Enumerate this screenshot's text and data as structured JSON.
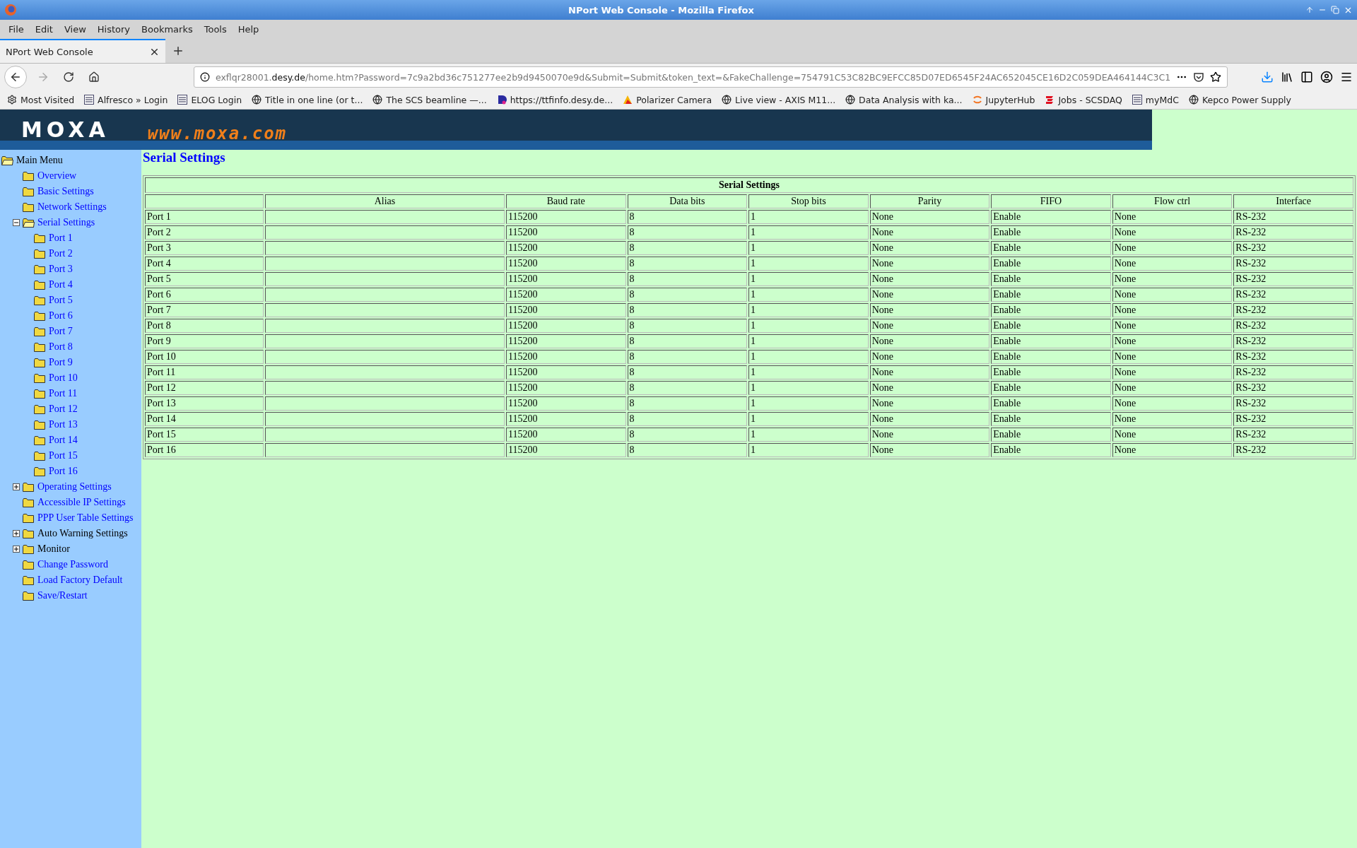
{
  "window": {
    "title": "NPort Web Console - Mozilla Firefox"
  },
  "menu_bar": [
    "File",
    "Edit",
    "View",
    "History",
    "Bookmarks",
    "Tools",
    "Help"
  ],
  "tabs": [
    {
      "label": "NPort Web Console",
      "selected": true
    }
  ],
  "url": {
    "subdomain": "exflqr28001.",
    "domain": "desy.de",
    "path": "/home.htm?Password=7c9a2bd36c751277ee2b9d9450070e9d&Submit=Submit&token_text=&FakeChallenge=754791C53C82BC9EFCC85D07ED6545F24AC652045CE16D2C059DEA464144C3C1"
  },
  "bookmarks": [
    "Most Visited",
    "Alfresco » Login",
    "ELOG Login",
    "Title in one line (or t...",
    "The SCS beamline —...",
    "https://ttfinfo.desy.de...",
    "Polarizer Camera",
    "Live view - AXIS M11...",
    "Data Analysis with ka...",
    "JupyterHub",
    "Jobs - SCSDAQ",
    "myMdC",
    "Kepco Power Supply"
  ],
  "banner": {
    "logo": "MOXA",
    "site": "www.moxa.com"
  },
  "sidebar": {
    "items": [
      {
        "label": "Main Menu",
        "link": false,
        "expanded": true,
        "children": [
          {
            "label": "Overview",
            "link": true
          },
          {
            "label": "Basic Settings",
            "link": true
          },
          {
            "label": "Network Settings",
            "link": true
          },
          {
            "label": "Serial Settings",
            "link": true,
            "expanded": true,
            "children": [
              {
                "label": "Port 1",
                "link": true
              },
              {
                "label": "Port 2",
                "link": true
              },
              {
                "label": "Port 3",
                "link": true
              },
              {
                "label": "Port 4",
                "link": true
              },
              {
                "label": "Port 5",
                "link": true
              },
              {
                "label": "Port 6",
                "link": true
              },
              {
                "label": "Port 7",
                "link": true
              },
              {
                "label": "Port 8",
                "link": true
              },
              {
                "label": "Port 9",
                "link": true
              },
              {
                "label": "Port 10",
                "link": true
              },
              {
                "label": "Port 11",
                "link": true
              },
              {
                "label": "Port 12",
                "link": true
              },
              {
                "label": "Port 13",
                "link": true
              },
              {
                "label": "Port 14",
                "link": true
              },
              {
                "label": "Port 15",
                "link": true
              },
              {
                "label": "Port 16",
                "link": true
              }
            ]
          },
          {
            "label": "Operating Settings",
            "link": true,
            "expanded": false
          },
          {
            "label": "Accessible IP Settings",
            "link": true
          },
          {
            "label": "PPP User Table Settings",
            "link": true
          },
          {
            "label": "Auto Warning Settings",
            "link": false,
            "expanded": false
          },
          {
            "label": "Monitor",
            "link": false,
            "expanded": false
          },
          {
            "label": "Change Password",
            "link": true
          },
          {
            "label": "Load Factory Default",
            "link": true
          },
          {
            "label": "Save/Restart",
            "link": true
          }
        ]
      }
    ]
  },
  "page_title": "Serial Settings",
  "table": {
    "caption": "Serial Settings",
    "columns": [
      "Alias",
      "Baud rate",
      "Data bits",
      "Stop bits",
      "Parity",
      "FIFO",
      "Flow ctrl",
      "Interface"
    ],
    "rows": [
      {
        "port": "Port 1",
        "baud_rate": "115200",
        "data_bits": "8",
        "stop_bits": "1",
        "parity": "None",
        "fifo": "Enable",
        "flow_ctrl": "None",
        "interface": "RS-232"
      },
      {
        "port": "Port 2",
        "baud_rate": "115200",
        "data_bits": "8",
        "stop_bits": "1",
        "parity": "None",
        "fifo": "Enable",
        "flow_ctrl": "None",
        "interface": "RS-232"
      },
      {
        "port": "Port 3",
        "baud_rate": "115200",
        "data_bits": "8",
        "stop_bits": "1",
        "parity": "None",
        "fifo": "Enable",
        "flow_ctrl": "None",
        "interface": "RS-232"
      },
      {
        "port": "Port 4",
        "baud_rate": "115200",
        "data_bits": "8",
        "stop_bits": "1",
        "parity": "None",
        "fifo": "Enable",
        "flow_ctrl": "None",
        "interface": "RS-232"
      },
      {
        "port": "Port 5",
        "baud_rate": "115200",
        "data_bits": "8",
        "stop_bits": "1",
        "parity": "None",
        "fifo": "Enable",
        "flow_ctrl": "None",
        "interface": "RS-232"
      },
      {
        "port": "Port 6",
        "baud_rate": "115200",
        "data_bits": "8",
        "stop_bits": "1",
        "parity": "None",
        "fifo": "Enable",
        "flow_ctrl": "None",
        "interface": "RS-232"
      },
      {
        "port": "Port 7",
        "baud_rate": "115200",
        "data_bits": "8",
        "stop_bits": "1",
        "parity": "None",
        "fifo": "Enable",
        "flow_ctrl": "None",
        "interface": "RS-232"
      },
      {
        "port": "Port 8",
        "baud_rate": "115200",
        "data_bits": "8",
        "stop_bits": "1",
        "parity": "None",
        "fifo": "Enable",
        "flow_ctrl": "None",
        "interface": "RS-232"
      },
      {
        "port": "Port 9",
        "baud_rate": "115200",
        "data_bits": "8",
        "stop_bits": "1",
        "parity": "None",
        "fifo": "Enable",
        "flow_ctrl": "None",
        "interface": "RS-232"
      },
      {
        "port": "Port 10",
        "baud_rate": "115200",
        "data_bits": "8",
        "stop_bits": "1",
        "parity": "None",
        "fifo": "Enable",
        "flow_ctrl": "None",
        "interface": "RS-232"
      },
      {
        "port": "Port 11",
        "baud_rate": "115200",
        "data_bits": "8",
        "stop_bits": "1",
        "parity": "None",
        "fifo": "Enable",
        "flow_ctrl": "None",
        "interface": "RS-232"
      },
      {
        "port": "Port 12",
        "baud_rate": "115200",
        "data_bits": "8",
        "stop_bits": "1",
        "parity": "None",
        "fifo": "Enable",
        "flow_ctrl": "None",
        "interface": "RS-232"
      },
      {
        "port": "Port 13",
        "baud_rate": "115200",
        "data_bits": "8",
        "stop_bits": "1",
        "parity": "None",
        "fifo": "Enable",
        "flow_ctrl": "None",
        "interface": "RS-232"
      },
      {
        "port": "Port 14",
        "baud_rate": "115200",
        "data_bits": "8",
        "stop_bits": "1",
        "parity": "None",
        "fifo": "Enable",
        "flow_ctrl": "None",
        "interface": "RS-232"
      },
      {
        "port": "Port 15",
        "baud_rate": "115200",
        "data_bits": "8",
        "stop_bits": "1",
        "parity": "None",
        "fifo": "Enable",
        "flow_ctrl": "None",
        "interface": "RS-232"
      },
      {
        "port": "Port 16",
        "baud_rate": "115200",
        "data_bits": "8",
        "stop_bits": "1",
        "parity": "None",
        "fifo": "Enable",
        "flow_ctrl": "None",
        "interface": "RS-232"
      }
    ]
  }
}
